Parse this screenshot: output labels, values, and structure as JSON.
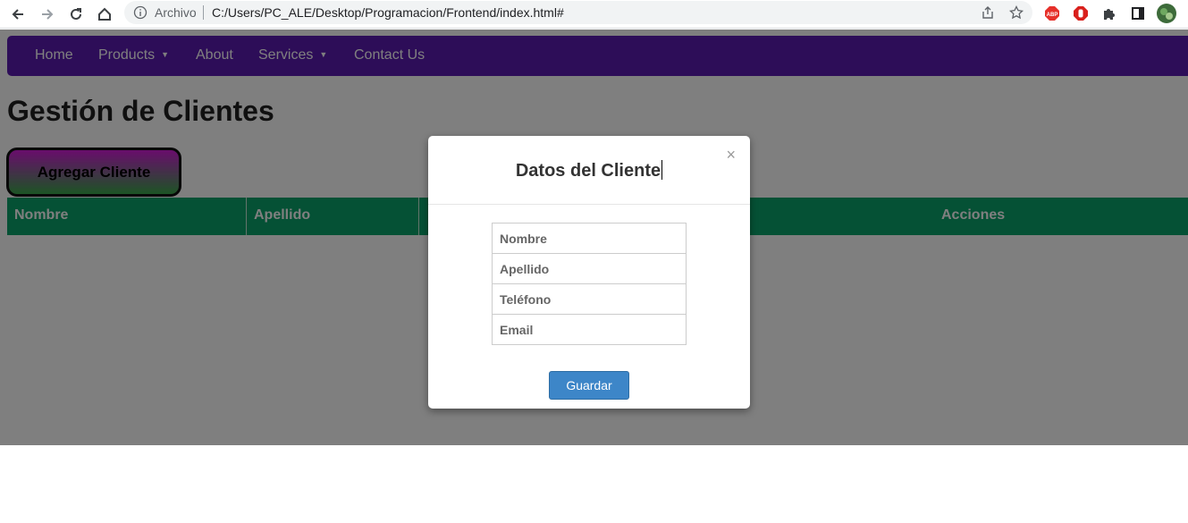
{
  "browser": {
    "scheme_label": "Archivo",
    "url": "C:/Users/PC_ALE/Desktop/Programacion/Frontend/index.html#",
    "extensions": [
      "adblock-icon",
      "stop-icon",
      "puzzle-icon",
      "sidepanel-icon",
      "profile-avatar"
    ]
  },
  "navbar": {
    "items": [
      {
        "label": "Home",
        "caret": ""
      },
      {
        "label": "Products",
        "caret": "▼"
      },
      {
        "label": "About",
        "caret": ""
      },
      {
        "label": "Services",
        "caret": "▼"
      },
      {
        "label": "Contact Us",
        "caret": ""
      }
    ],
    "color": "#5b1ab0"
  },
  "page": {
    "title": "Gestión de Clientes",
    "add_button": "Agregar Cliente"
  },
  "table": {
    "headers": [
      "Nombre",
      "Apellido",
      "",
      "",
      "Acciones"
    ]
  },
  "modal": {
    "title": "Datos del Cliente",
    "close": "×",
    "fields": [
      {
        "placeholder": "Nombre"
      },
      {
        "placeholder": "Apellido"
      },
      {
        "placeholder": "Teléfono"
      },
      {
        "placeholder": "Email"
      }
    ],
    "save_label": "Guardar"
  },
  "colors": {
    "table_header": "#0ba36a",
    "save_button": "#3d86c8"
  }
}
